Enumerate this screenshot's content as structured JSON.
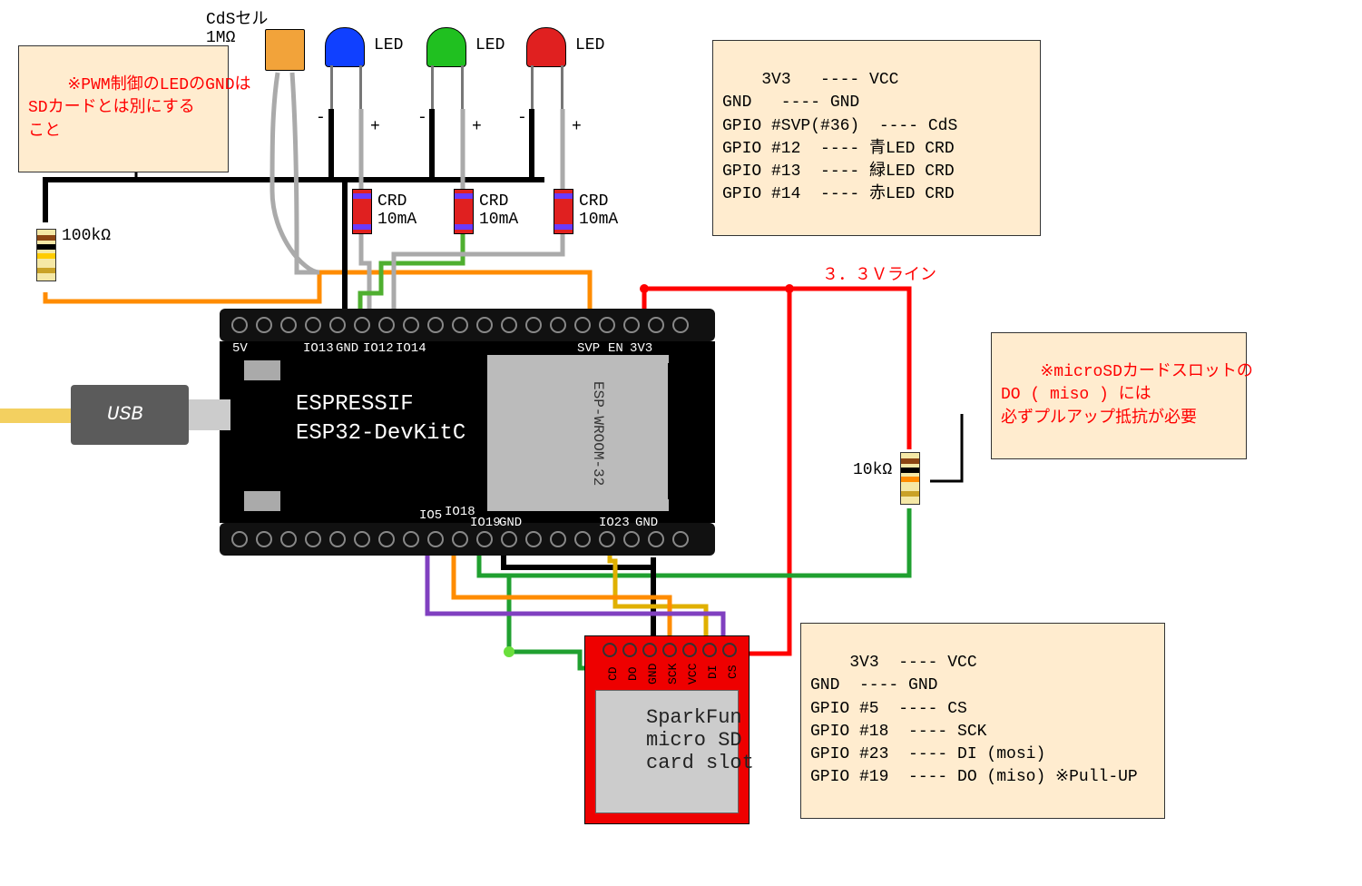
{
  "notes": {
    "pwm_gnd": "※PWM制御のLEDのGNDは\nSDカードとは別にする\nこと",
    "pullup": "※microSDカードスロットの\nDO ( miso ) には\n必ずプルアップ抵抗が必要"
  },
  "line_label_3v3": "３．３Ｖライン",
  "components": {
    "cds": {
      "label": "CdSセル\n1MΩ"
    },
    "led_blue": {
      "label": "LED",
      "color": "#1040ff"
    },
    "led_green": {
      "label": "LED",
      "color": "#20c020"
    },
    "led_red": {
      "label": "LED",
      "color": "#e02020"
    },
    "r100k": "100kΩ",
    "r10k": "10kΩ",
    "crd_label": "CRD\n10mA"
  },
  "board": {
    "brand": "ESPRESSIF",
    "model": "ESP32-DevKitC",
    "module": "ESP-WROOM-32",
    "usb": "USB",
    "top_pins": [
      "5V",
      "IO13",
      "GND",
      "IO12",
      "IO14",
      "SVP",
      "EN",
      "3V3"
    ],
    "bottom_pins": [
      "IO5",
      "IO18",
      "IO19",
      "GND",
      "IO23",
      "GND"
    ]
  },
  "sdcard": {
    "title": "SparkFun\nmicro SD\ncard slot",
    "pins": [
      "CD",
      "DO",
      "GND",
      "SCK",
      "VCC",
      "DI",
      "CS"
    ]
  },
  "mapping_top": "3V3   ---- VCC\nGND   ---- GND\nGPIO #SVP(#36)  ---- CdS\nGPIO #12  ---- 青LED CRD\nGPIO #13  ---- 緑LED CRD\nGPIO #14  ---- 赤LED CRD",
  "mapping_sd": "3V3  ---- VCC\nGND  ---- GND\nGPIO #5  ---- CS\nGPIO #18  ---- SCK\nGPIO #19  ---- DO (miso) ※Pull-UP\nGPIO #23  ---- DI (mosi)",
  "mapping_sd_display": "3V3  ---- VCC\nGND  ---- GND\nGPIO #5  ---- CS\nGPIO #18  ---- SCK\nGPIO #23  ---- DI (mosi)\nGPIO #19  ---- DO (miso) ※Pull-UP",
  "polarity": {
    "minus": "-",
    "plus": "+"
  }
}
